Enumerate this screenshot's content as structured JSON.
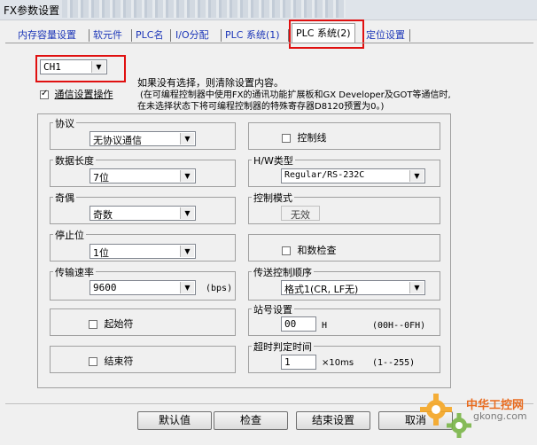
{
  "window": {
    "title": "FX参数设置"
  },
  "tabs": [
    {
      "label": "内存容量设置"
    },
    {
      "label": "软元件"
    },
    {
      "label": "PLC名"
    },
    {
      "label": "I/O分配"
    },
    {
      "label": "PLC 系统(1)"
    },
    {
      "label": "PLC 系统(2)"
    },
    {
      "label": "定位设置"
    }
  ],
  "channel": {
    "selected": "CH1"
  },
  "comm_settings": {
    "label": "通信设置操作",
    "checked": true,
    "note_line1": "如果没有选择，则清除设置内容。",
    "note_line2": "(在可编程控制器中使用FX的通讯功能扩展板和GX Developer及GOT等通信时,",
    "note_line3": "在未选择状态下将可编程控制器的特殊寄存器D8120预置为0。)"
  },
  "protocol": {
    "label": "协议",
    "value": "无协议通信"
  },
  "data_length": {
    "label": "数据长度",
    "value": "7位"
  },
  "parity": {
    "label": "奇偶",
    "value": "奇数"
  },
  "stop_bit": {
    "label": "停止位",
    "value": "1位"
  },
  "baud_rate": {
    "label": "传输速率",
    "value": "9600",
    "unit": "(bps)"
  },
  "header": {
    "label": "起始符",
    "checked": false
  },
  "terminator": {
    "label": "结束符",
    "checked": false
  },
  "control_line": {
    "label": "控制线",
    "checked": false
  },
  "hw_type": {
    "label": "H/W类型",
    "value": "Regular/RS-232C"
  },
  "control_mode": {
    "label": "控制模式",
    "value": "无效"
  },
  "sum_check": {
    "label": "和数检查",
    "checked": false
  },
  "transmission_control": {
    "label": "传送控制顺序",
    "value": "格式1(CR, LF无)"
  },
  "station_no": {
    "label": "站号设置",
    "value": "00",
    "unit": "H",
    "range": "(00H--0FH)"
  },
  "timeout": {
    "label": "超时判定时间",
    "value": "1",
    "unit": "×10ms",
    "range": "(1--255)"
  },
  "buttons": {
    "default": "默认值",
    "check": "检查",
    "end_setting": "结束设置",
    "cancel": "取消"
  },
  "watermark": {
    "text_cn": "中华工控网",
    "text_url": "gkong.com"
  },
  "colors": {
    "highlight": "#e01010",
    "tab_text": "#1c36b8"
  }
}
